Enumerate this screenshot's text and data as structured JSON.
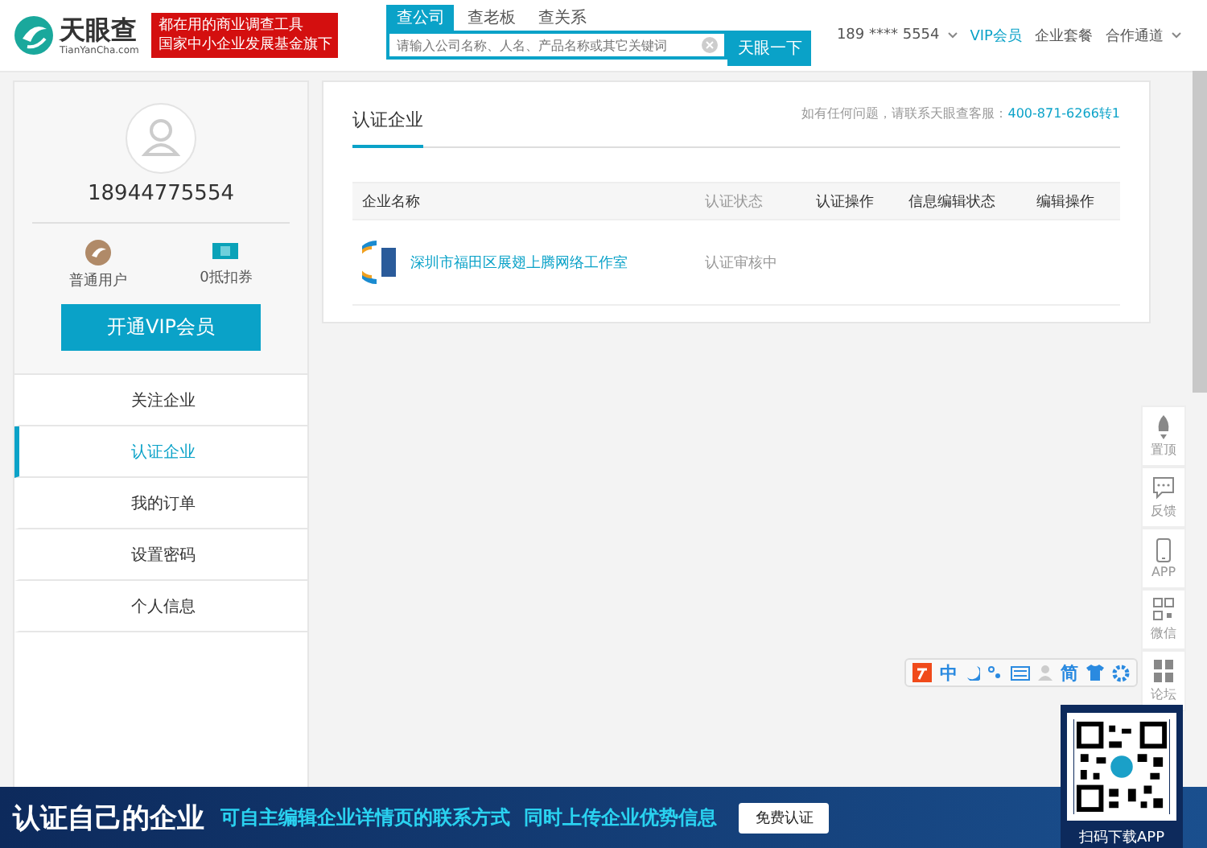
{
  "header": {
    "logo_name": "天眼查",
    "logo_sub": "TianYanCha.com",
    "slogan": [
      "都在用的商业调查工具",
      "国家中小企业发展基金旗下"
    ],
    "search_tabs": [
      {
        "label": "查公司",
        "selected": true
      },
      {
        "label": "查老板",
        "selected": false
      },
      {
        "label": "查关系",
        "selected": false
      }
    ],
    "search": {
      "placeholder": "请输入公司名称、人名、产品名称或其它关键词",
      "button": "天眼一下"
    },
    "nav": [
      {
        "label": "189 **** 5554",
        "kind": "dropdown"
      },
      {
        "label": "VIP会员",
        "kind": "link"
      },
      {
        "label": "企业套餐",
        "kind": "plain"
      },
      {
        "label": "合作通道",
        "kind": "dropdown"
      }
    ]
  },
  "sidebar": {
    "username": "18944775554",
    "stats": [
      {
        "label": "普通用户",
        "kind": "level"
      },
      {
        "label": "0抵扣券",
        "kind": "coupon"
      }
    ],
    "vip_button": "开通VIP会员",
    "items": [
      {
        "label": "关注企业",
        "selected": false
      },
      {
        "label": "认证企业",
        "selected": true
      },
      {
        "label": "我的订单",
        "selected": false
      },
      {
        "label": "设置密码",
        "selected": false
      },
      {
        "label": "个人信息",
        "selected": false
      }
    ]
  },
  "main": {
    "title": "认证企业",
    "help_text": "如有任何问题，请联系天眼查客服：",
    "help_phone": "400-871-6266转1",
    "table": {
      "columns": [
        "企业名称",
        "认证状态",
        "认证操作",
        "信息编辑状态",
        "编辑操作"
      ],
      "rows": [
        {
          "name": "深圳市福田区展翅上腾网络工作室",
          "status": "认证审核中"
        }
      ]
    }
  },
  "float_bar": [
    {
      "label": "置顶",
      "kind": "top"
    },
    {
      "label": "反馈",
      "kind": "feedback"
    },
    {
      "label": "APP",
      "kind": "phone"
    },
    {
      "label": "微信",
      "kind": "qr"
    },
    {
      "label": "论坛",
      "kind": "forum"
    }
  ],
  "ime_toolbar": [
    "中",
    "简"
  ],
  "qr_panel": {
    "caption": "扫码下载APP"
  },
  "banner": {
    "title": "认证自己的企业",
    "text": "可自主编辑企业详情页的联系方式  同时上传企业优势信息",
    "button": "免费认证"
  }
}
